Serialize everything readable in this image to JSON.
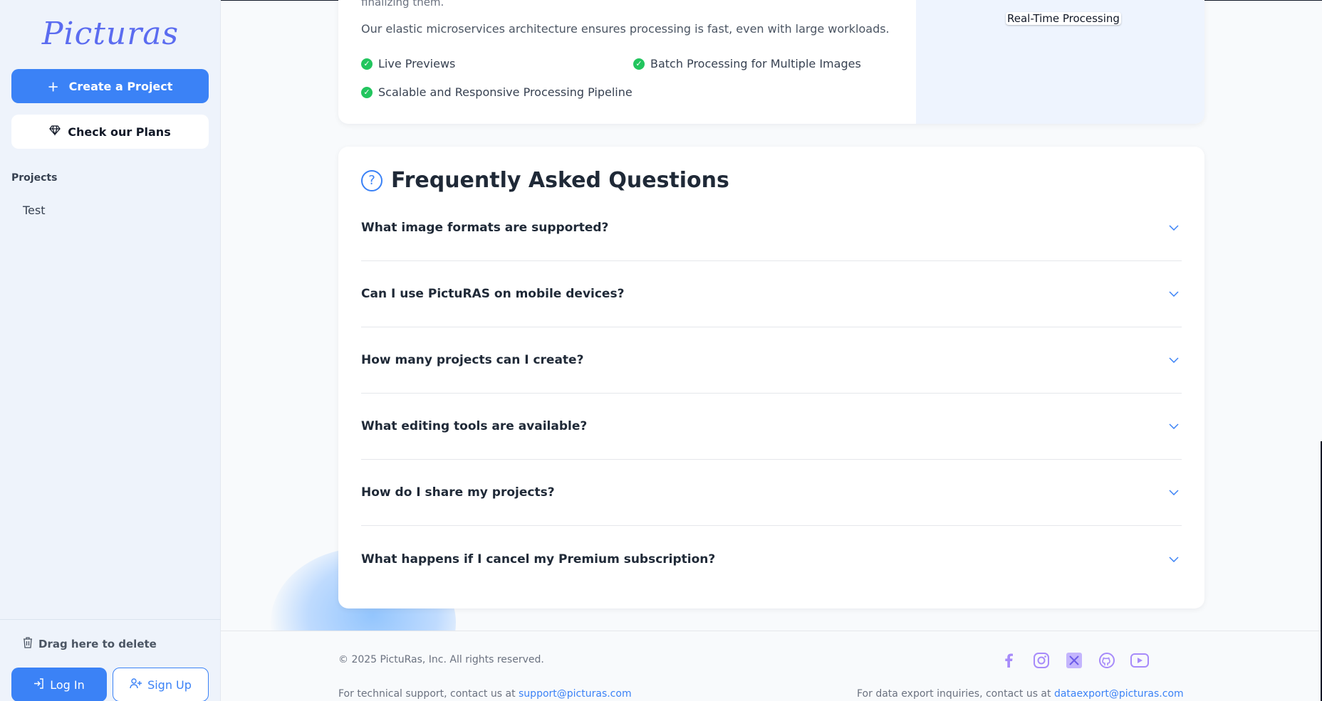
{
  "sidebar": {
    "logo": "Picturas",
    "create_label": "Create a Project",
    "plans_label": "Check our Plans",
    "projects_heading": "Projects",
    "projects": [
      "Test"
    ],
    "drag_delete": "Drag here to delete",
    "login_label": "Log In",
    "signup_label": "Sign Up"
  },
  "feature_card": {
    "cut_text": "finalizing them.",
    "description": "Our elastic microservices architecture ensures processing is fast, even with large workloads.",
    "features": [
      "Live Previews",
      "Batch Processing for Multiple Images",
      "Scalable and Responsive Processing Pipeline"
    ],
    "panel_label": "Real-Time Processing"
  },
  "faq": {
    "title": "Frequently Asked Questions",
    "items": [
      "What image formats are supported?",
      "Can I use PictuRAS on mobile devices?",
      "How many projects can I create?",
      "What editing tools are available?",
      "How do I share my projects?",
      "What happens if I cancel my Premium subscription?"
    ]
  },
  "footer": {
    "copyright": "© 2025 PictuRas, Inc. All rights reserved.",
    "support_text": "For technical support, contact us at ",
    "support_email": "support@picturas.com",
    "export_text": "For data export inquiries, contact us at ",
    "export_email": "dataexport@picturas.com",
    "socials": [
      "facebook-icon",
      "instagram-icon",
      "x-icon",
      "github-icon",
      "youtube-icon"
    ]
  },
  "colors": {
    "accent": "#3b82f6",
    "success": "#22c55e",
    "logo": "#5b6cf0"
  }
}
